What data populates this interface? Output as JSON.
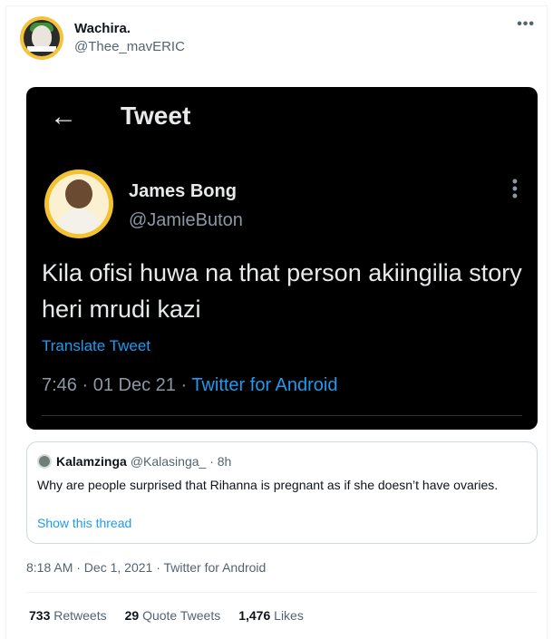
{
  "author": {
    "display_name": "Wachira.",
    "handle": "@Thee_mavERIC",
    "more_icon": "more-horizontal-icon"
  },
  "embedded_screenshot": {
    "back_icon": "arrow-left-icon",
    "header_title": "Tweet",
    "display_name": "James Bong",
    "handle": "@JamieButon",
    "text": "Kila ofisi huwa na that person akiingilia story heri mrudi kazi",
    "translate_label": "Translate Tweet",
    "time": "7:46",
    "date": "01 Dec 21",
    "source": "Twitter for Android"
  },
  "quoted_tweet": {
    "display_name": "Kalamzinga",
    "handle": "@Kalasinga_",
    "age": "8h",
    "text": "Why are people surprised that Rihanna is pregnant as if she doesn’t have ovaries.",
    "thread_link": "Show this thread"
  },
  "timestamp": "8:18 AM · Dec 1, 2021 · Twitter for Android",
  "stats": {
    "retweets_count": "733",
    "retweets_label": "Retweets",
    "quotes_count": "29",
    "quotes_label": "Quote Tweets",
    "likes_count": "1,476",
    "likes_label": "Likes"
  }
}
